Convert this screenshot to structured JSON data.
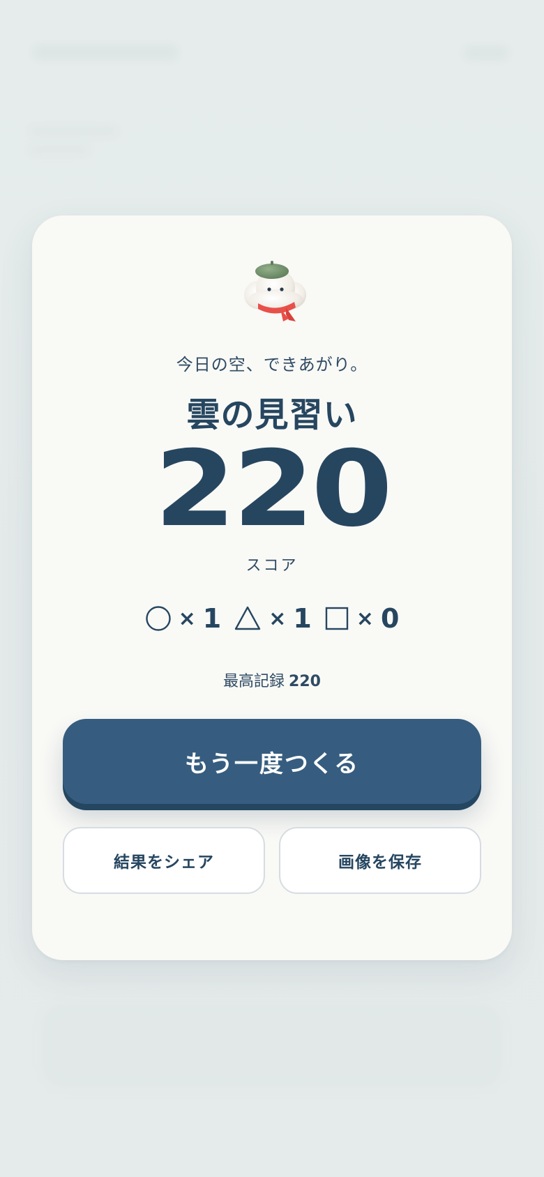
{
  "result_card": {
    "tagline": "今日の空、できあがり。",
    "rank_title": "雲の見習い",
    "score": "220",
    "score_label": "スコア",
    "counts": [
      {
        "shape": "circle",
        "times": "×",
        "count": "1"
      },
      {
        "shape": "triangle",
        "times": "×",
        "count": "1"
      },
      {
        "shape": "square",
        "times": "×",
        "count": "0"
      }
    ],
    "best_label": "最高記録",
    "best_value": "220",
    "retry_button": "もう一度つくる",
    "share_button": "結果をシェア",
    "save_button": "画像を保存"
  },
  "icons": {
    "mascot": "cloud-mascot-with-beret-icon"
  },
  "colors": {
    "primary": "#365d7f",
    "text": "#264660",
    "card": "#f9f9f6",
    "beret": "#7a9a72",
    "scarf": "#e8504a"
  }
}
